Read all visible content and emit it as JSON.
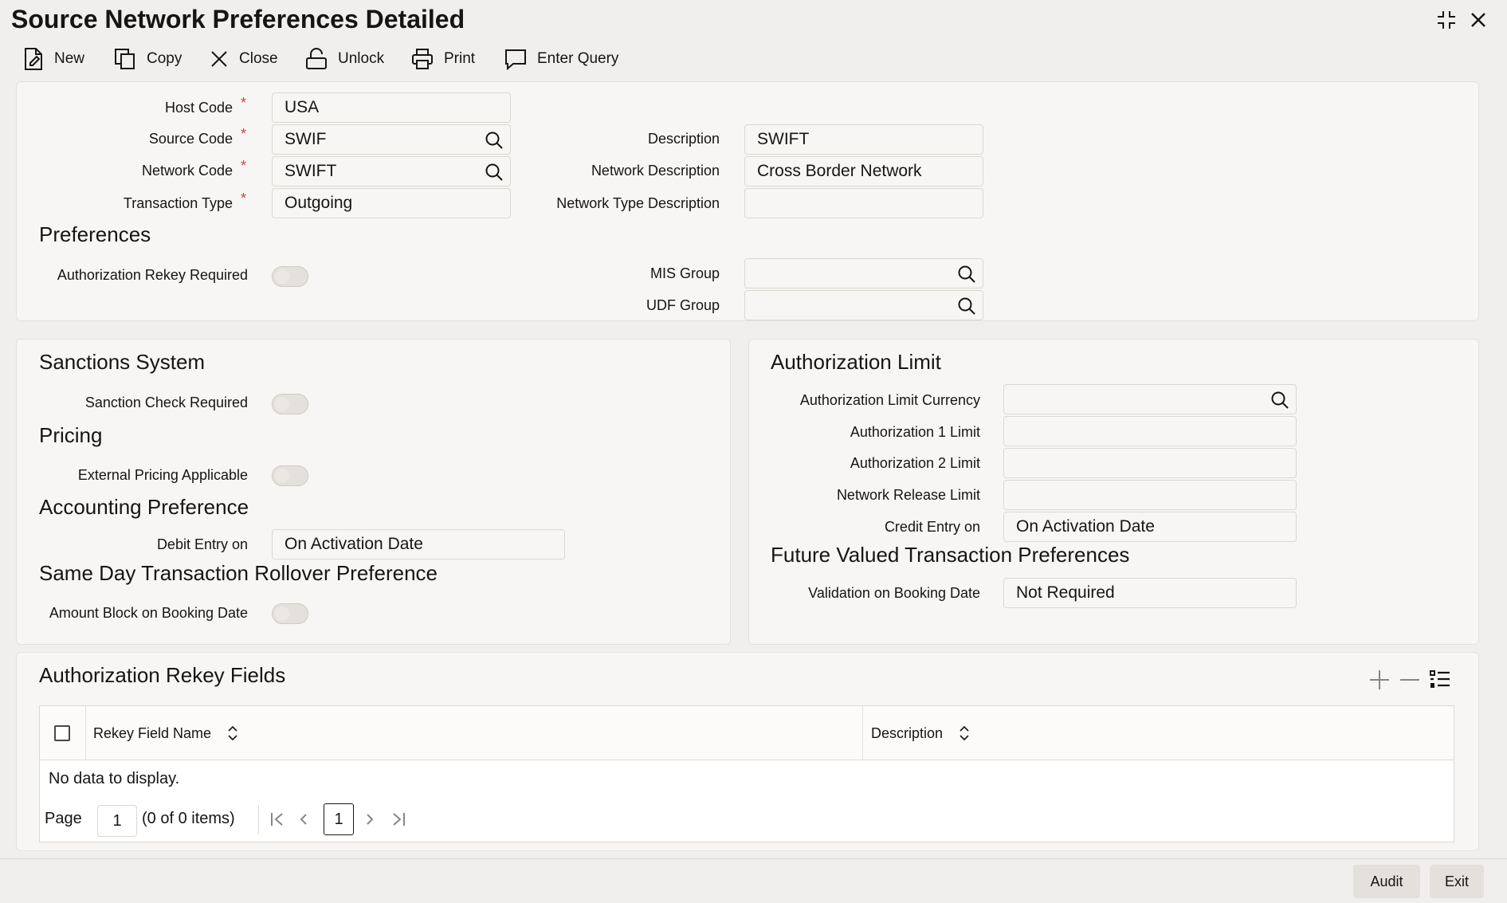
{
  "window": {
    "title": "Source Network Preferences Detailed"
  },
  "toolbar": {
    "new": "New",
    "copy": "Copy",
    "close": "Close",
    "unlock": "Unlock",
    "print": "Print",
    "enter_query": "Enter Query"
  },
  "header": {
    "host_code_label": "Host Code",
    "host_code": "USA",
    "source_code_label": "Source Code",
    "source_code": "SWIF",
    "network_code_label": "Network Code",
    "network_code": "SWIFT",
    "transaction_type_label": "Transaction Type",
    "transaction_type": "Outgoing",
    "description_label": "Description",
    "description": "SWIFT",
    "network_description_label": "Network Description",
    "network_description": "Cross Border Network",
    "network_type_description_label": "Network Type Description",
    "network_type_description": "",
    "required_marker": "*"
  },
  "preferences": {
    "title": "Preferences",
    "auth_rekey_label": "Authorization Rekey Required",
    "mis_group_label": "MIS Group",
    "mis_group": "",
    "udf_group_label": "UDF Group",
    "udf_group": ""
  },
  "left_panel": {
    "sanctions_title": "Sanctions System",
    "sanction_check_label": "Sanction Check Required",
    "pricing_title": "Pricing",
    "external_pricing_label": "External Pricing Applicable",
    "accounting_title": "Accounting Preference",
    "debit_entry_label": "Debit Entry on",
    "debit_entry": "On Activation Date",
    "rollover_title": "Same Day Transaction Rollover Preference",
    "amount_block_label": "Amount Block on Booking Date"
  },
  "right_panel": {
    "auth_limit_title": "Authorization Limit",
    "auth_limit_currency_label": "Authorization Limit Currency",
    "auth_limit_currency": "",
    "auth1_label": "Authorization 1 Limit",
    "auth1": "",
    "auth2_label": "Authorization 2 Limit",
    "auth2": "",
    "network_release_label": "Network Release Limit",
    "network_release": "",
    "credit_entry_label": "Credit Entry on",
    "credit_entry": "On Activation Date",
    "future_title": "Future Valued Transaction Preferences",
    "validation_label": "Validation on Booking Date",
    "validation": "Not Required"
  },
  "rekey_fields": {
    "title": "Authorization Rekey Fields",
    "col_field_name": "Rekey Field Name",
    "col_description": "Description",
    "no_data": "No data to display.",
    "page_label": "Page",
    "page_value": "1",
    "items_info": "(0 of 0 items)",
    "current_page": "1"
  },
  "footer": {
    "audit": "Audit",
    "exit": "Exit"
  }
}
